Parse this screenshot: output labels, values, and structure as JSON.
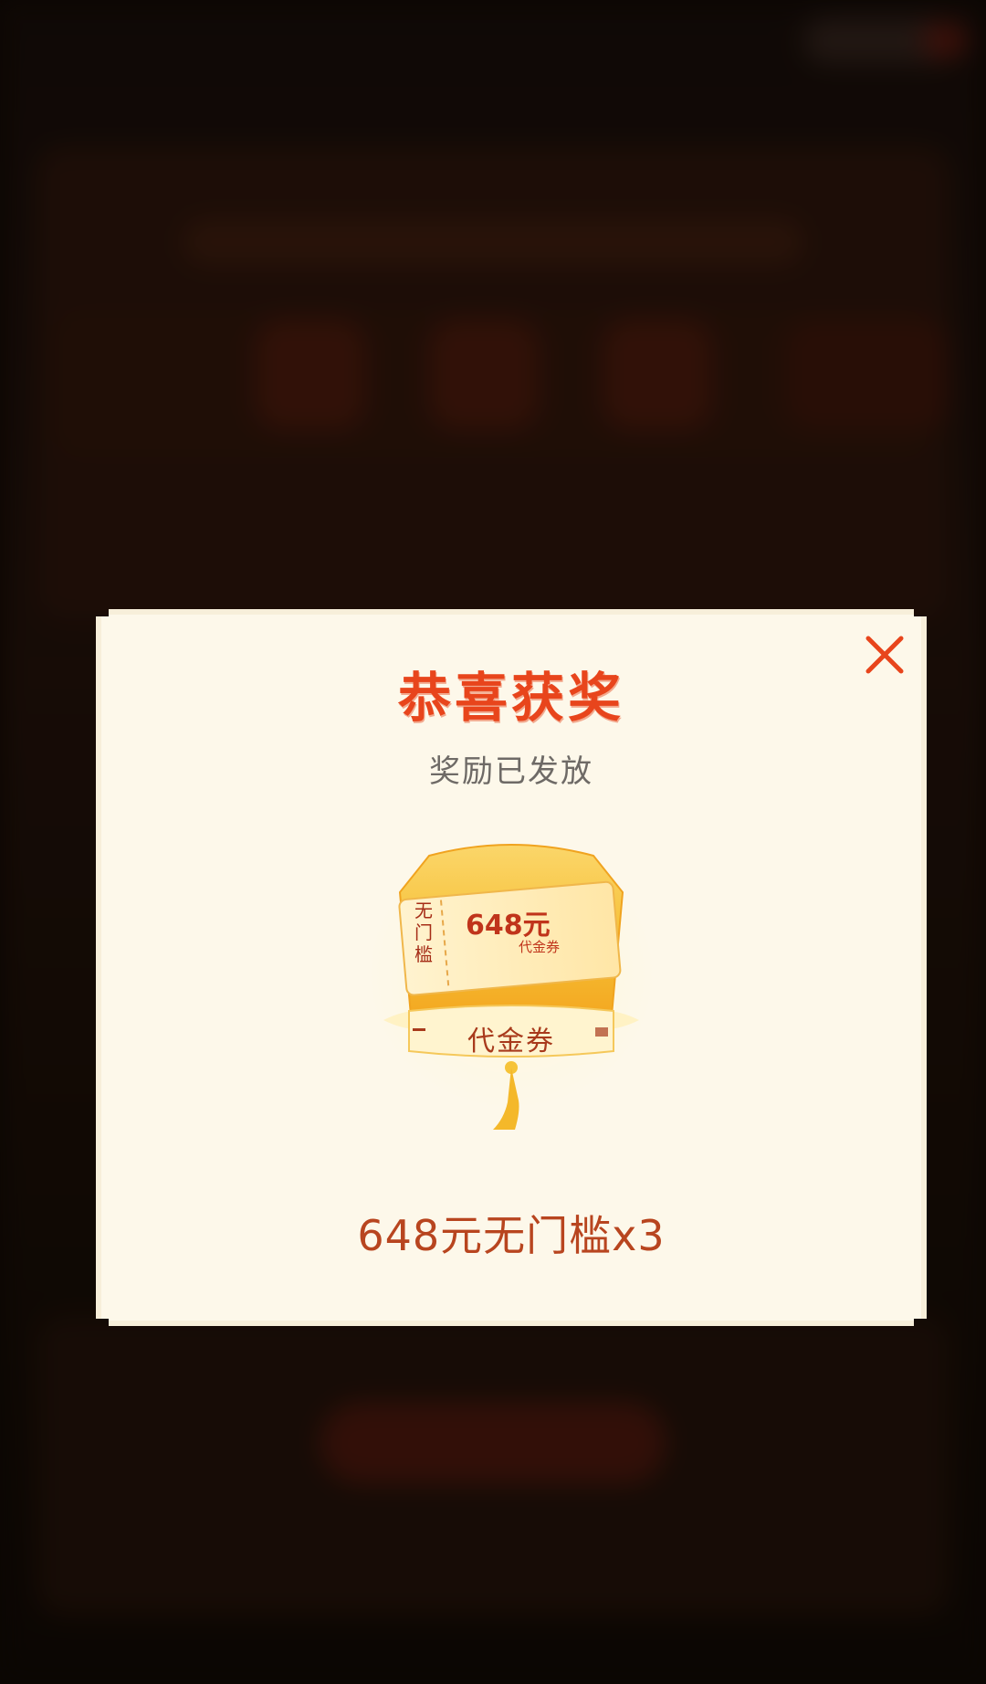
{
  "modal": {
    "title": "恭喜获奖",
    "subtitle": "奖励已发放",
    "close_icon": "close-icon"
  },
  "prize": {
    "ticket_amount": "648元",
    "ticket_type": "代金券",
    "ticket_side": [
      "无",
      "门",
      "槛"
    ],
    "band_label": "代金券",
    "result_text": "648元无门槛x3"
  },
  "colors": {
    "title": "#e8451c",
    "accent": "#e8451c",
    "modal_bg": "#fdf8ea",
    "gold": "#f6c338"
  }
}
